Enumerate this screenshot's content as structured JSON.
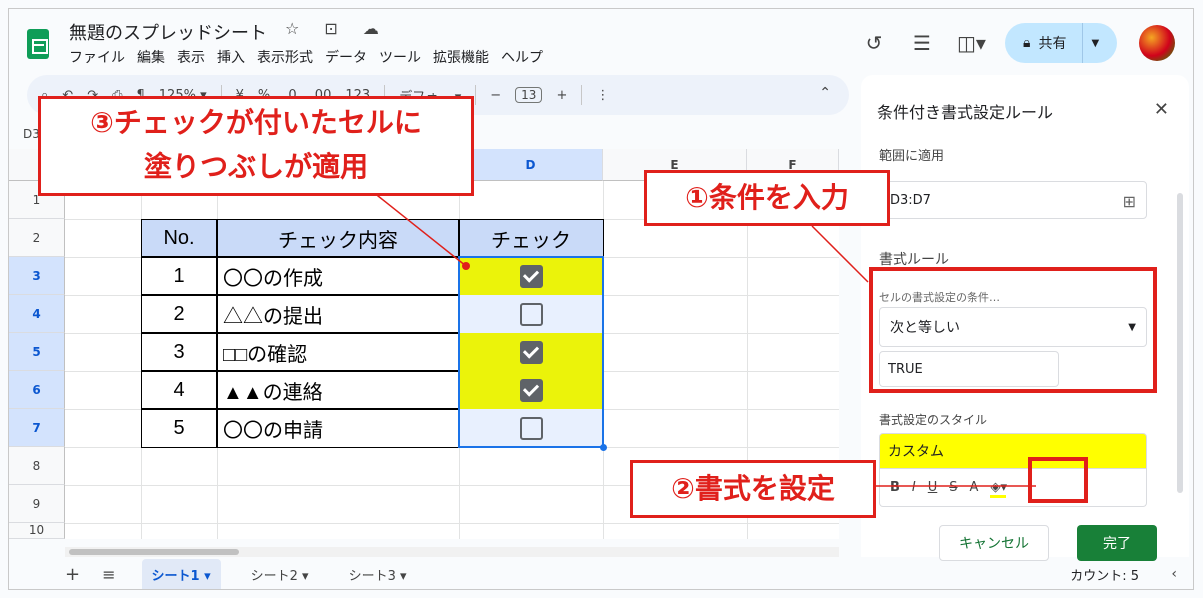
{
  "app": {
    "doc_title": "無題のスプレッドシート",
    "title_icons": "☆ ⊡ ☁",
    "menu": [
      "ファイル",
      "編集",
      "表示",
      "挿入",
      "表示形式",
      "データ",
      "ツール",
      "拡張機能",
      "ヘルプ"
    ],
    "share_label": "共有",
    "top_icons": [
      "history-icon",
      "comment-icon",
      "meet-icon"
    ]
  },
  "toolbar": {
    "zoom": "125%",
    "currency": "¥",
    "percent": "%",
    "dec_less": ".0",
    "dec_more": ".00",
    "num_format": "123",
    "font": "デフォ...",
    "font_size": "13",
    "minus": "−",
    "plus": "+",
    "more": "⋮"
  },
  "namebox": "D3",
  "grid": {
    "columns": [
      "D",
      "E",
      "F"
    ],
    "rows": [
      "1",
      "2",
      "3",
      "4",
      "5",
      "6",
      "7",
      "8",
      "9",
      "10"
    ],
    "table_headers": [
      "No.",
      "チェック内容",
      "チェック"
    ],
    "table_rows": [
      {
        "no": "1",
        "item": "〇〇の作成",
        "checked": true
      },
      {
        "no": "2",
        "item": "△△の提出",
        "checked": false
      },
      {
        "no": "3",
        "item": "□□の確認",
        "checked": true
      },
      {
        "no": "4",
        "item": "▲▲の連絡",
        "checked": true
      },
      {
        "no": "5",
        "item": "〇〇の申請",
        "checked": false
      }
    ]
  },
  "sheets": {
    "tabs": [
      "シート1",
      "シート2",
      "シート3"
    ],
    "count_label": "カウント: 5"
  },
  "panel": {
    "title": "条件付き書式設定ルール",
    "range_label": "範囲に適用",
    "range_value": "D3:D7",
    "rules_label": "書式ルール",
    "condition_label": "セルの書式設定の条件…",
    "condition_value": "次と等しい",
    "value_input": "TRUE",
    "style_label": "書式設定のスタイル",
    "style_preview": "カスタム",
    "style_tools": [
      "B",
      "I",
      "U",
      "S",
      "A"
    ],
    "cancel_label": "キャンセル",
    "done_label": "完了"
  },
  "annotations": {
    "step1": "①条件を入力",
    "step2": "②書式を設定",
    "step3_line1": "③チェックが付いたセルに",
    "step3_line2": "塗りつぶしが適用"
  },
  "colors": {
    "highlight_fill": "#ebf30a",
    "header_fill": "#c9daf8",
    "annotation_red": "#e0201b",
    "done_button": "#188038"
  }
}
